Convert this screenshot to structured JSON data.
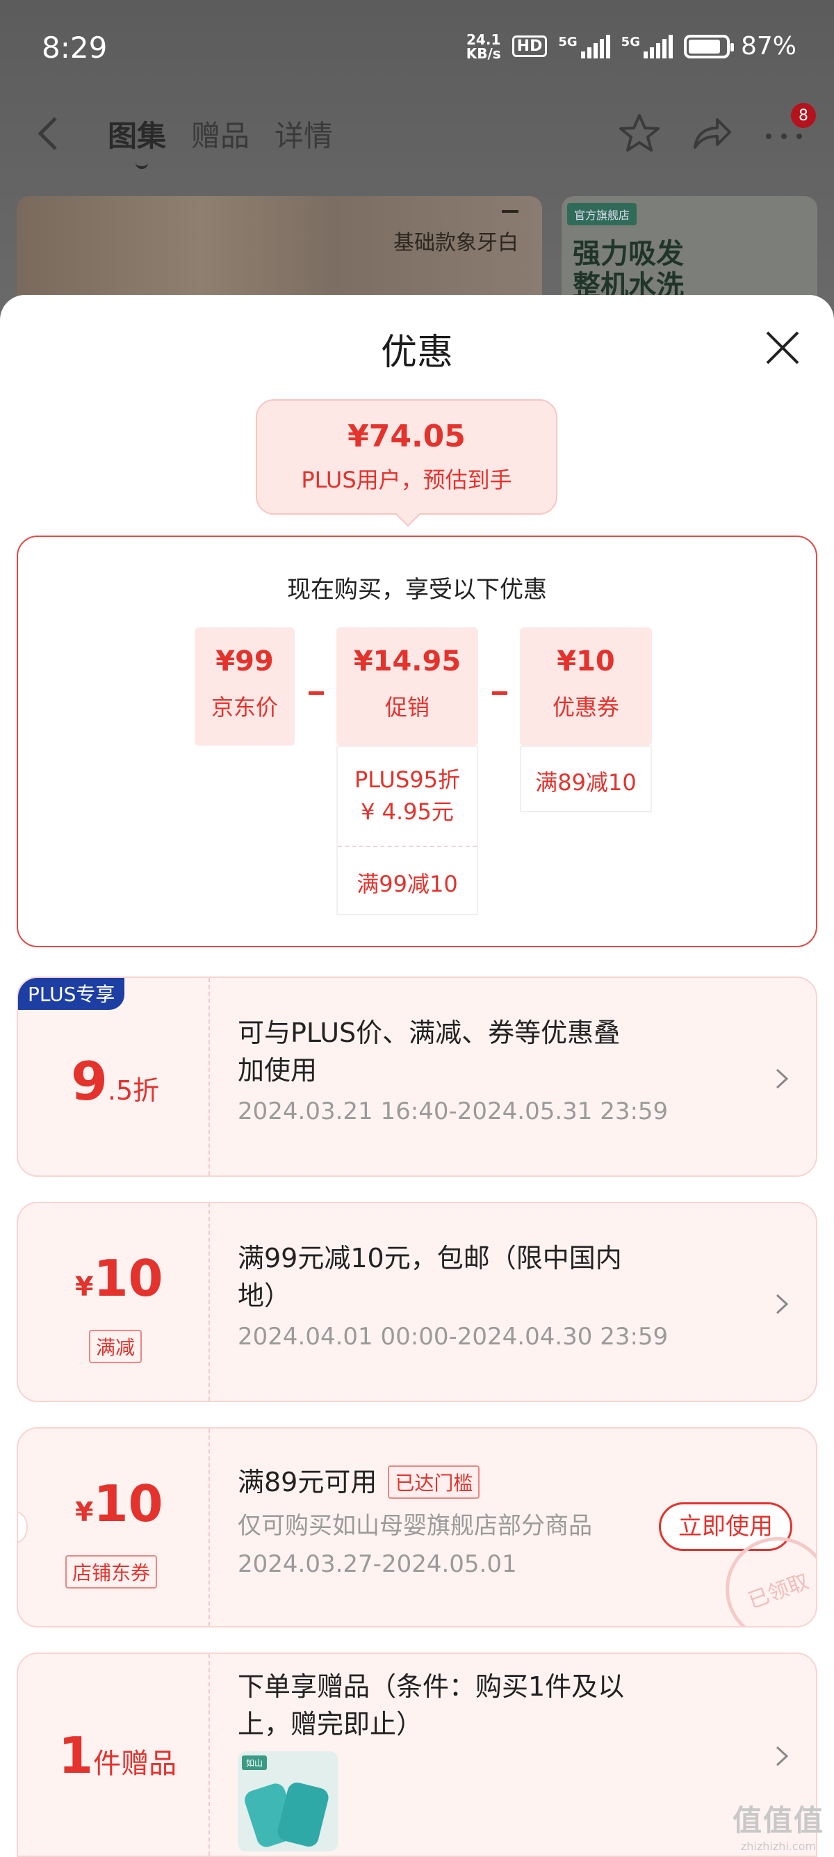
{
  "status_bar": {
    "time": "8:29",
    "net_speed_value": "24.1",
    "net_speed_unit": "KB/s",
    "hd_label": "HD",
    "signal1_label": "5G",
    "signal2_label": "5G",
    "battery_percent": "87%"
  },
  "nav": {
    "back_icon": "chevron-left-icon",
    "tabs": [
      {
        "label": "图集",
        "active": true
      },
      {
        "label": "赠品",
        "active": false
      },
      {
        "label": "详情",
        "active": false
      }
    ],
    "more_badge": "8"
  },
  "background_preview": {
    "left_caption": "基础款象牙白",
    "right_tag": "官方旗舰店",
    "right_caption_line1": "强力吸发",
    "right_caption_line2": "整机水洗"
  },
  "sheet": {
    "title": "优惠",
    "price_bubble": {
      "price": "¥74.05",
      "description": "PLUS用户，预估到手"
    },
    "calc": {
      "title": "现在购买，享受以下优惠",
      "columns": [
        {
          "value": "¥99",
          "label": "京东价"
        },
        {
          "value": "¥14.95",
          "label": "促销"
        },
        {
          "value": "¥10",
          "label": "优惠券"
        }
      ],
      "promo_details": {
        "line1": "PLUS95折",
        "line2": "¥ 4.95元",
        "line3": "满99减10"
      },
      "coupon_details": {
        "line1": "满89减10"
      }
    }
  },
  "cards": {
    "plus": {
      "tag": "PLUS专享",
      "discount_big": "9",
      "discount_small": ".5折",
      "desc_line1": "可与PLUS价、满减、券等优惠叠",
      "desc_line2": "加使用",
      "date": "2024.03.21 16:40-2024.05.31 23:59"
    },
    "full_reduction": {
      "currency": "¥",
      "amount": "10",
      "tag": "满减",
      "desc_line1": "满99元减10元，包邮（限中国内",
      "desc_line2": "地）",
      "date": "2024.04.01 00:00-2024.04.30 23:59"
    },
    "store_coupon": {
      "currency": "¥",
      "amount": "10",
      "tag": "店铺东券",
      "title": "满89元可用",
      "threshold_tag": "已达门槛",
      "scope": "仅可购买如山母婴旗舰店部分商品",
      "date": "2024.03.27-2024.05.01",
      "use_button": "立即使用",
      "stamp": "已领取"
    },
    "gift": {
      "count": "1",
      "unit": "件赠品",
      "desc_line1": "下单享赠品（条件：购买1件及以",
      "desc_line2": "上，赠完即止）",
      "thumb_logo": "如山"
    }
  },
  "watermark": {
    "top": "值值值",
    "bottom": "zhizhizhi.com"
  }
}
